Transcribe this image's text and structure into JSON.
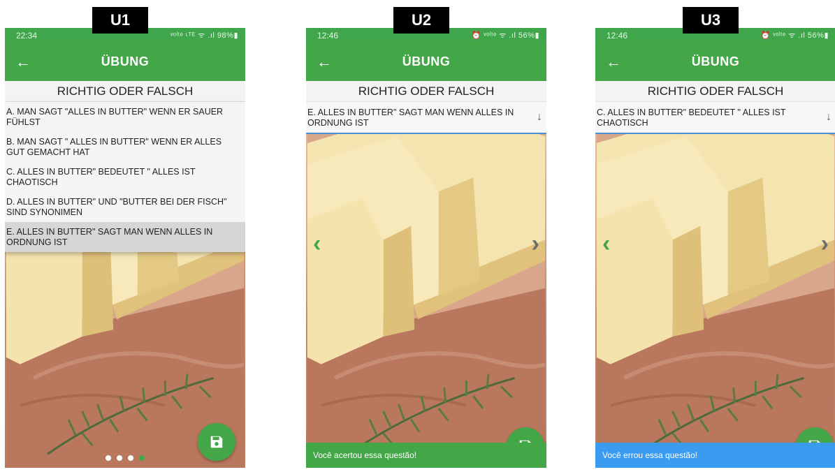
{
  "labels": {
    "u1": "U1",
    "u2": "U2",
    "u3": "U3"
  },
  "phones": [
    {
      "time": "22:34",
      "status_right": "ᵛᵒˡᵗᵉ ᶫᵀᴱ ᯤ .ıl 98%▮"
    },
    {
      "time": "12:46",
      "status_right": "⏰ ᵛᵒˡᵗᵉ ᯤ .ıl 56%▮"
    },
    {
      "time": "12:46",
      "status_right": "⏰ ᵛᵒˡᵗᵉ ᯤ .ıl 56%▮"
    }
  ],
  "app": {
    "title": "ÜBUNG",
    "back_icon": "←"
  },
  "question": {
    "header": "RICHTIG ODER FALSCH"
  },
  "options": [
    "A. MAN SAGT \"ALLES IN BUTTER\" WENN ER SAUER FÜHLST",
    "B. MAN SAGT \" ALLES IN BUTTER\" WENN ER ALLES GUT GEMACHT HAT",
    "C. ALLES IN BUTTER\" BEDEUTET \" ALLES IST CHAOTISCH",
    "D. ALLES IN BUTTER\" UND \"BUTTER BEI DER FISCH\" SIND SYNONIMEN",
    "E. ALLES IN BUTTER\" SAGT MAN WENN ALLES IN ORDNUNG IST"
  ],
  "selected": {
    "u2": "E. ALLES IN BUTTER\" SAGT MAN WENN ALLES IN ORDNUNG IST",
    "u3": "C. ALLES IN BUTTER\" BEDEUTET \" ALLES IST CHAOTISCH"
  },
  "icons": {
    "dropdown": "↓",
    "prev": "‹",
    "next": "›"
  },
  "snackbar": {
    "correct": "Você acertou essa questão!",
    "wrong": "Você errou essa questão!"
  },
  "colors": {
    "primary": "#43a748",
    "status_bar": "#3fa64b",
    "error_snackbar": "#3a9bf0",
    "dropdown_underline": "#4a90d9"
  },
  "pager": {
    "total": 4,
    "active": 4
  }
}
